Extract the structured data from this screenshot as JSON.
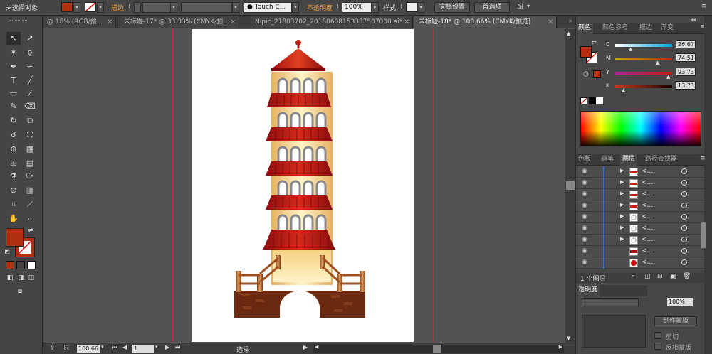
{
  "control_bar": {
    "selection_label": "未选择对象",
    "stroke_label": "描边",
    "brush_name": "Touch C...",
    "opacity_label": "不透明度",
    "opacity_value": "100%",
    "style_label": "样式",
    "doc_setup": "文档设置",
    "preferences": "首选项",
    "fill_color": "#b03010"
  },
  "doc_tabs": [
    {
      "label": "@ 18% (RGB/预..."
    },
    {
      "label": "未标题-17* @ 33.33% (CMYK/预..."
    },
    {
      "label": "Nipic_21803702_20180608153337507000.ai*"
    },
    {
      "label": "未标题-18* @ 100.66% (CMYK/预览)"
    }
  ],
  "color_panel": {
    "tabs": [
      "颜色",
      "颜色参考",
      "描边",
      "渐变"
    ],
    "c_label": "C",
    "c_value": "26.67",
    "m_label": "M",
    "m_value": "74.51",
    "y_label": "Y",
    "y_value": "93.73",
    "k_label": "K",
    "k_value": "13.73",
    "current_color": "#b03010"
  },
  "layers_panel": {
    "tabs": [
      "色板",
      "画笔",
      "图层",
      "路径查找器"
    ],
    "rows": [
      {
        "name": "<..."
      },
      {
        "name": "<..."
      },
      {
        "name": "<..."
      },
      {
        "name": "<..."
      },
      {
        "name": "<..."
      },
      {
        "name": "<..."
      },
      {
        "name": "<..."
      },
      {
        "name": "<..."
      },
      {
        "name": "<..."
      }
    ],
    "footer_count": "1 个图层"
  },
  "transparency_panel": {
    "tab": "透明度",
    "opacity_value": "100%",
    "make_mask": "制作蒙版",
    "clip": "剪切",
    "invert_mask": "反相蒙版"
  },
  "status_bar": {
    "zoom": "100.66",
    "page": "1",
    "tool_name": "选择"
  }
}
